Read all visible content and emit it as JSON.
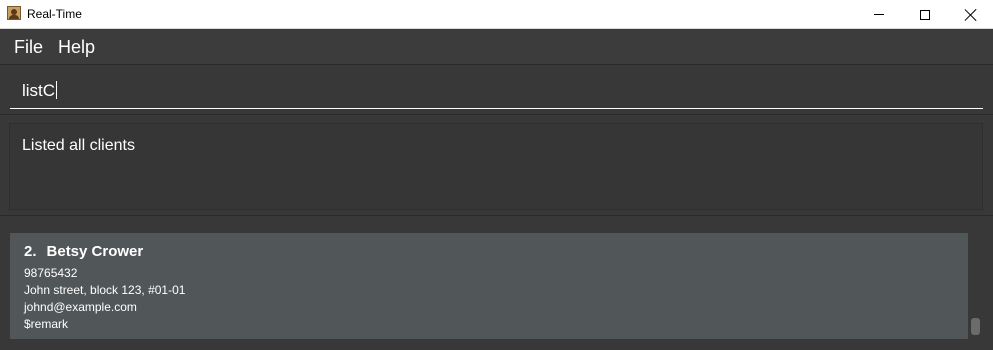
{
  "window": {
    "title": "Real-Time",
    "icon": "app-logo-icon"
  },
  "menu": {
    "items": [
      {
        "label": "File"
      },
      {
        "label": "Help"
      }
    ]
  },
  "command": {
    "value": "listC"
  },
  "result": {
    "text": "Listed all clients"
  },
  "client_list": {
    "items": [
      {
        "index": "2.",
        "name": "Betsy Crower",
        "phone": "98765432",
        "address": "John street, block 123, #01-01",
        "email": "johnd@example.com",
        "remark": "$remark"
      }
    ]
  },
  "colors": {
    "background": "#383838",
    "card": "#515658",
    "text": "#ffffff"
  }
}
